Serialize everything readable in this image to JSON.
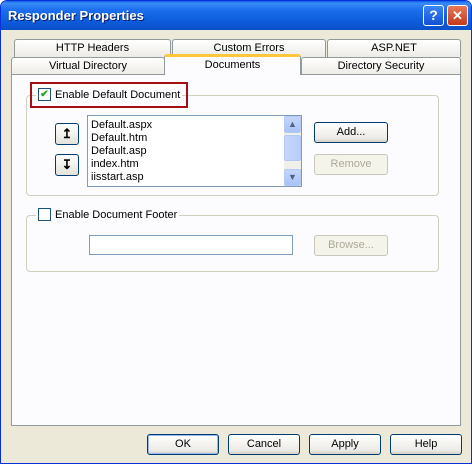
{
  "window": {
    "title": "Responder Properties",
    "help_glyph": "?",
    "close_glyph": "✕"
  },
  "tabs": {
    "http_headers": "HTTP Headers",
    "custom_errors": "Custom Errors",
    "aspnet": "ASP.NET",
    "virtual_directory": "Virtual Directory",
    "documents": "Documents",
    "directory_security": "Directory Security"
  },
  "default_document": {
    "label": "Enable Default Document",
    "checked": true,
    "check_glyph": "✔",
    "items": [
      "Default.aspx",
      "Default.htm",
      "Default.asp",
      "index.htm",
      "iisstart.asp"
    ],
    "move_up_glyph": "↥",
    "move_down_glyph": "↧",
    "add_label": "Add...",
    "remove_label": "Remove",
    "scroll_up_glyph": "▲",
    "scroll_down_glyph": "▼"
  },
  "document_footer": {
    "label": "Enable Document Footer",
    "checked": false,
    "path_value": "",
    "browse_label": "Browse..."
  },
  "footer_buttons": {
    "ok": "OK",
    "cancel": "Cancel",
    "apply": "Apply",
    "help": "Help"
  }
}
